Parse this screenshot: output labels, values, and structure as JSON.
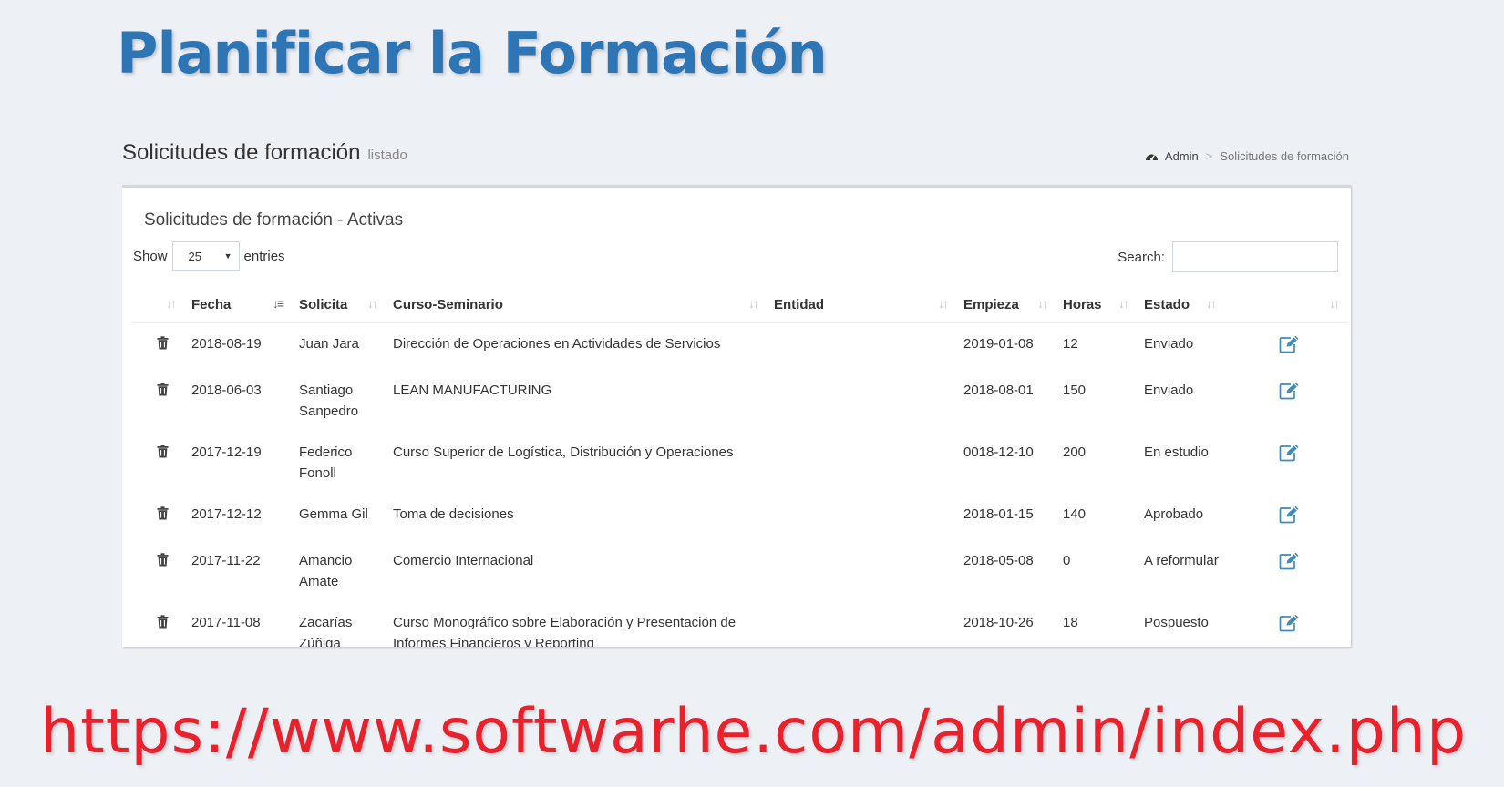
{
  "slide": {
    "title": "Planificar la Formación",
    "url": "https://www.softwarhe.com/admin/index.php"
  },
  "header": {
    "title": "Solicitudes de formación",
    "subtitle": "listado",
    "breadcrumb": {
      "icon": "dashboard-icon",
      "home": "Admin",
      "separator": ">",
      "current": "Solicitudes de formación"
    }
  },
  "box": {
    "title": "Solicitudes de formación - Activas",
    "length": {
      "prefix": "Show",
      "value": "25",
      "suffix": "entries"
    },
    "search": {
      "label": "Search:",
      "value": "",
      "placeholder": ""
    }
  },
  "table": {
    "columns": [
      "",
      "Fecha",
      "Solicita",
      "Curso-Seminario",
      "Entidad",
      "Empieza",
      "Horas",
      "Estado",
      ""
    ],
    "rows": [
      [
        "2018-08-19",
        "Juan Jara",
        "Dirección de Operaciones en Actividades de Servicios",
        "",
        "2019-01-08",
        "12",
        "Enviado"
      ],
      [
        "2018-06-03",
        "Santiago Sanpedro",
        "LEAN MANUFACTURING",
        "",
        "2018-08-01",
        "150",
        "Enviado"
      ],
      [
        "2017-12-19",
        "Federico Fonoll",
        "Curso Superior de Logística, Distribución y Operaciones",
        "",
        "0018-12-10",
        "200",
        "En estudio"
      ],
      [
        "2017-12-12",
        "Gemma Gil",
        "Toma de decisiones",
        "",
        "2018-01-15",
        "140",
        "Aprobado"
      ],
      [
        "2017-11-22",
        "Amancio Amate",
        "Comercio Internacional",
        "",
        "2018-05-08",
        "0",
        "A reformular"
      ],
      [
        "2017-11-08",
        "Zacarías Zúñiga",
        "Curso Monográfico sobre Elaboración y Presentación de Informes Financieros y Reporting",
        "",
        "2018-10-26",
        "18",
        "Pospuesto"
      ]
    ]
  },
  "colors": {
    "title": "#2e75b6",
    "url": "#e8212c",
    "background": "#edf0f5",
    "edit_icon": "#3c8dbc",
    "trash_icon": "#444444"
  },
  "icons": {
    "delete": "trash-icon",
    "edit": "edit-icon",
    "sort": "sort-icon"
  }
}
